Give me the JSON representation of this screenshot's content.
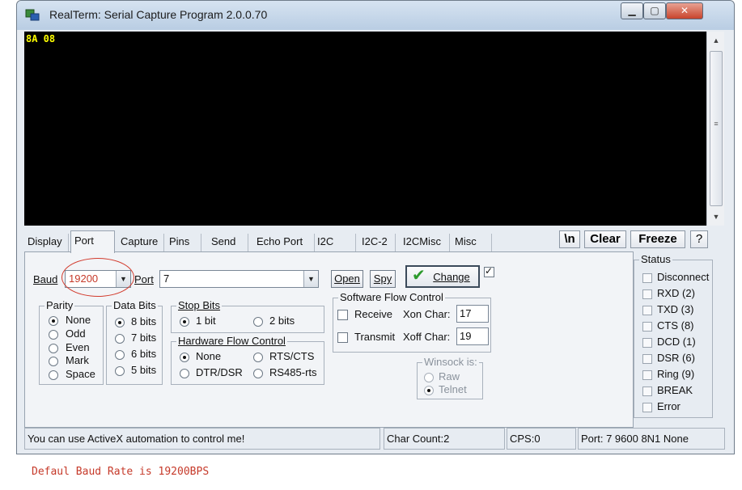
{
  "window": {
    "title": "RealTerm: Serial Capture Program 2.0.0.70"
  },
  "terminal": {
    "text": "8A 08"
  },
  "tabs": [
    "Display",
    "Port",
    "Capture",
    "Pins",
    "Send",
    "Echo Port",
    "I2C",
    "I2C-2",
    "I2CMisc",
    "Misc"
  ],
  "toolbar": {
    "newline": "\\n",
    "clear": "Clear",
    "freeze": "Freeze",
    "help": "?"
  },
  "port": {
    "baud_label": "Baud",
    "baud_value": "19200",
    "port_label": "Port",
    "port_value": "7",
    "open": "Open",
    "spy": "Spy",
    "change": "Change"
  },
  "parity": {
    "label": "Parity",
    "options": [
      "None",
      "Odd",
      "Even",
      "Mark",
      "Space"
    ],
    "selected": "None"
  },
  "data_bits": {
    "label": "Data Bits",
    "options": [
      "8 bits",
      "7 bits",
      "6 bits",
      "5 bits"
    ],
    "selected": "8 bits"
  },
  "stop_bits": {
    "label": "Stop Bits",
    "options": [
      "1 bit",
      "2 bits"
    ],
    "selected": "1 bit"
  },
  "hw_flow": {
    "label": "Hardware Flow Control",
    "options": [
      "None",
      "RTS/CTS",
      "DTR/DSR",
      "RS485-rts"
    ],
    "selected": "None"
  },
  "sw_flow": {
    "label": "Software Flow Control",
    "receive": "Receive",
    "transmit": "Transmit",
    "xon_label": "Xon Char:",
    "xon_value": "17",
    "xoff_label": "Xoff Char:",
    "xoff_value": "19"
  },
  "winsock": {
    "label": "Winsock is:",
    "options": [
      "Raw",
      "Telnet"
    ],
    "selected": "Telnet"
  },
  "status": {
    "label": "Status",
    "items": [
      "Disconnect",
      "RXD (2)",
      "TXD (3)",
      "CTS (8)",
      "DCD (1)",
      "DSR (6)",
      "Ring (9)",
      "BREAK",
      "Error"
    ]
  },
  "statusbar": {
    "message": "You can use ActiveX automation to control me!",
    "char_count": "Char Count:2",
    "cps": "CPS:0",
    "port_info": "Port: 7 9600 8N1 None"
  },
  "caption": "Defaul Baud Rate is 19200BPS",
  "colors": {
    "terminal_bg": "#000000",
    "terminal_text": "#ffff00",
    "annotation": "#c63a2a"
  }
}
